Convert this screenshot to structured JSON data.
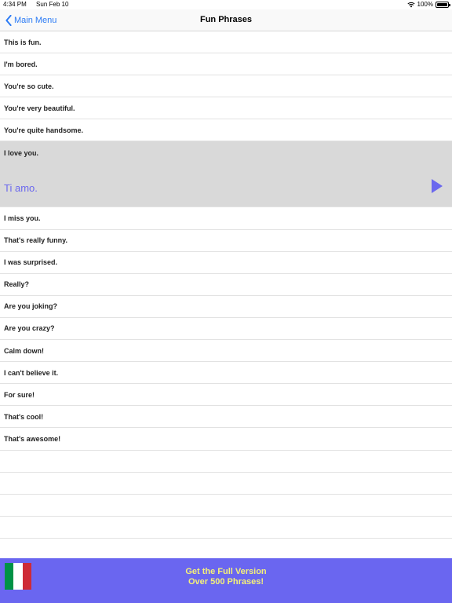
{
  "status_bar": {
    "time": "4:34 PM",
    "date": "Sun Feb 10",
    "battery": "100%"
  },
  "nav": {
    "back_label": "Main Menu",
    "title": "Fun Phrases"
  },
  "phrases_top": [
    "This is fun.",
    "I'm bored.",
    "You're so cute.",
    "You're very beautiful.",
    "You're quite handsome."
  ],
  "selected": {
    "phrase": "I love you.",
    "translation": "Ti amo."
  },
  "phrases_bottom": [
    "I miss you.",
    "That's really funny.",
    "I was surprised.",
    "Really?",
    "Are you joking?",
    "Are you crazy?",
    "Calm down!",
    "I can't believe it.",
    "For sure!",
    "That's cool!",
    "That's awesome!"
  ],
  "banner": {
    "line1": "Get the Full Version",
    "line2": "Over 500 Phrases!"
  },
  "colors": {
    "accent": "#2a7af5",
    "translation": "#6b68ee",
    "banner_bg": "#6a66f0",
    "banner_text": "#f4f07a",
    "flag": [
      "#009246",
      "#ffffff",
      "#ce2b37"
    ]
  },
  "icons": {
    "back": "chevron-left-icon",
    "play": "play-icon",
    "flag": "italy-flag-icon",
    "wifi": "wifi-icon",
    "battery": "battery-icon"
  }
}
